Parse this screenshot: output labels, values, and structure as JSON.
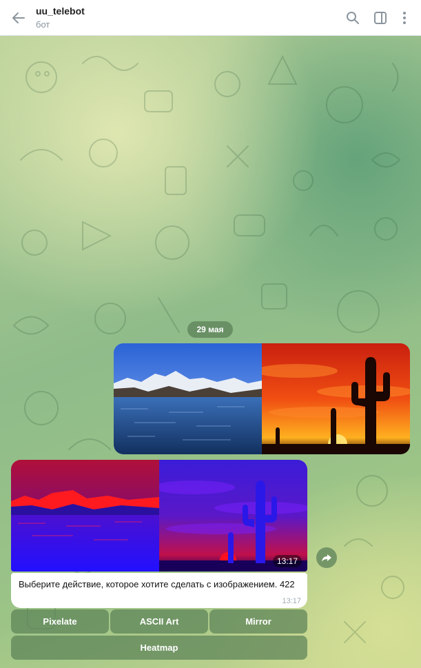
{
  "header": {
    "title": "uu_telebot",
    "subtitle": "бот"
  },
  "date_separator": "29 мая",
  "incoming_album": {
    "time": "13:17"
  },
  "message": {
    "text": "Выберите действие, которое хотите сделать с изображением. 422",
    "time": "13:17"
  },
  "keyboard": {
    "pixelate": "Pixelate",
    "ascii": "ASCII Art",
    "mirror": "Mirror",
    "heatmap": "Heatmap"
  },
  "colors": {
    "accent": "#5c8258",
    "header_bg": "#ffffff",
    "bubble_bg": "#ffffff"
  },
  "icons": [
    "back-arrow-icon",
    "search-icon",
    "sidebar-toggle-icon",
    "more-vertical-icon",
    "forward-icon"
  ]
}
